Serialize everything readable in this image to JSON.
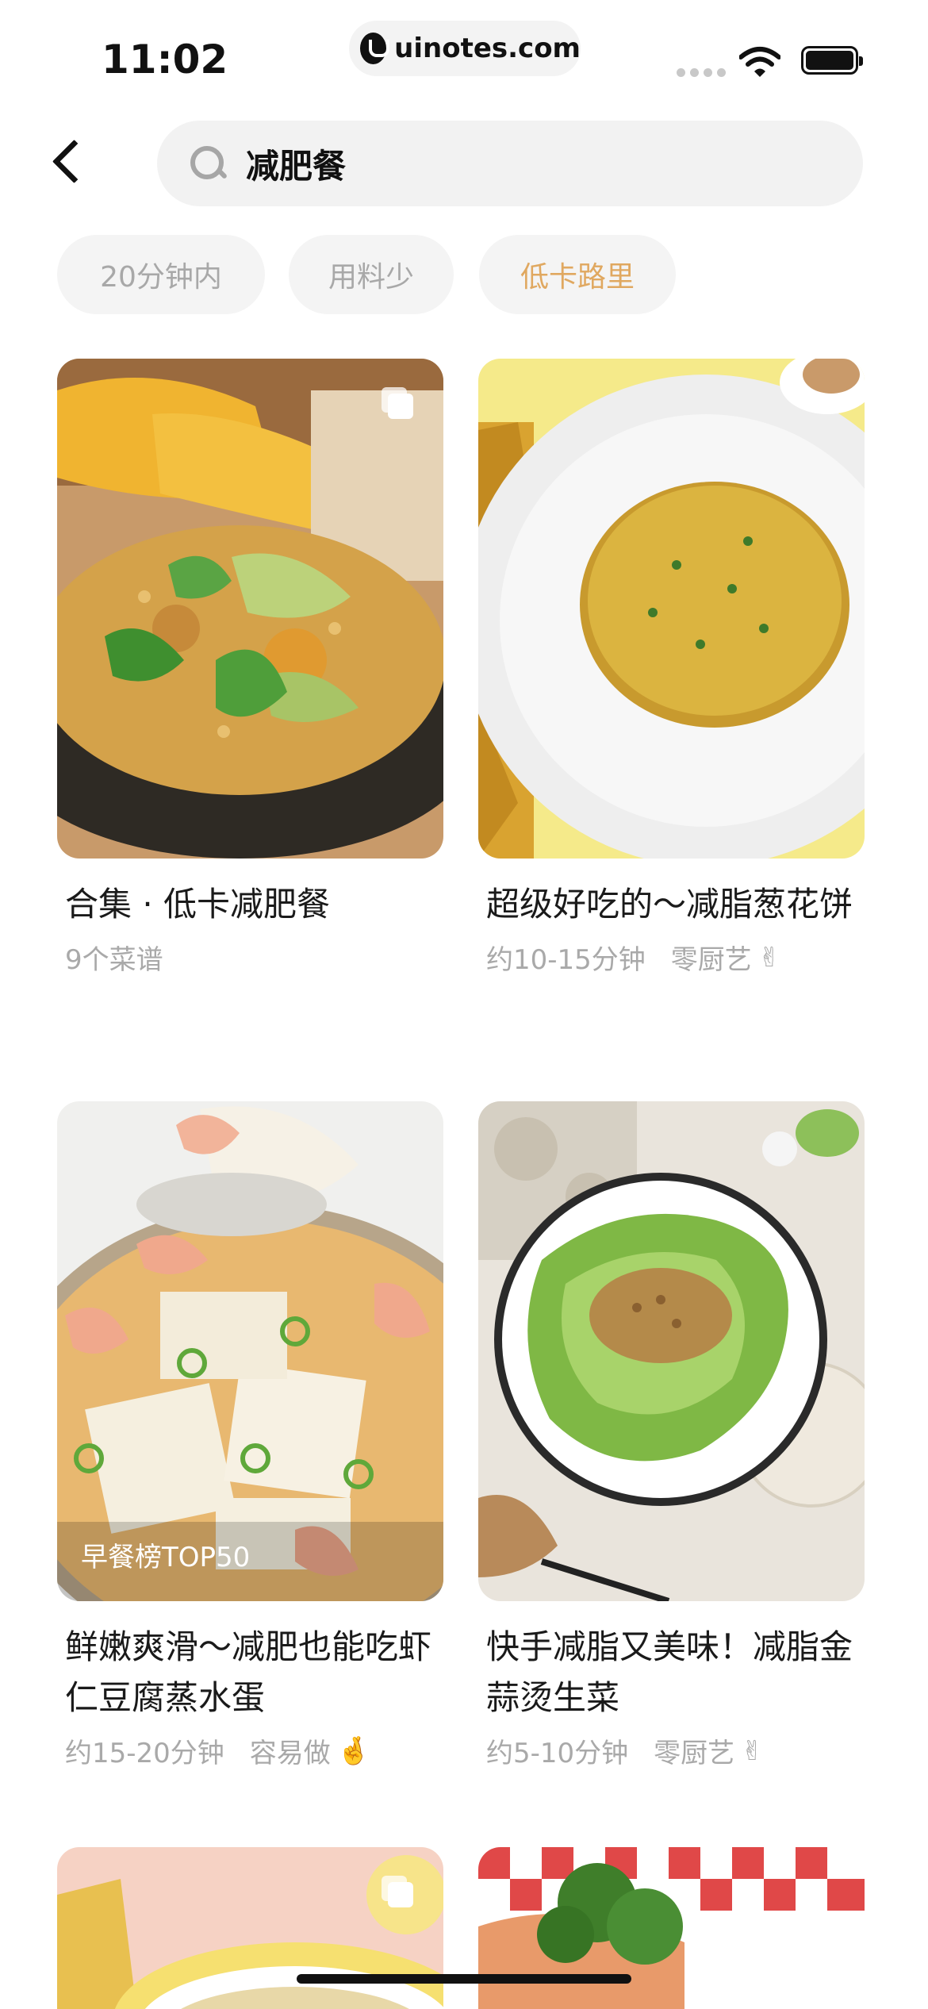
{
  "status_bar": {
    "time": "11:02",
    "url": "uinotes.com"
  },
  "search": {
    "query": "减肥餐"
  },
  "filters": [
    {
      "label": "20分钟内",
      "active": false
    },
    {
      "label": "用料少",
      "active": false
    },
    {
      "label": "低卡路里",
      "active": true
    }
  ],
  "cards": [
    {
      "title": "合集 · 低卡减肥餐",
      "meta": "9个菜谱",
      "meta_extra": "",
      "image_desc": "quinoa-avocado-salad-icon",
      "badge": ""
    },
    {
      "title": "超级好吃的～减脂葱花饼",
      "meta": "约10-15分钟",
      "meta_extra": "零厨艺",
      "image_desc": "egg-pancake-icon",
      "badge": ""
    },
    {
      "title": "鲜嫩爽滑～减肥也能吃虾仁豆腐蒸水蛋",
      "meta": "约15-20分钟",
      "meta_extra": "容易做",
      "image_desc": "shrimp-tofu-icon",
      "badge": "早餐榜TOP50"
    },
    {
      "title": "快手减脂又美味！减脂金蒜烫生菜",
      "meta": "约5-10分钟",
      "meta_extra": "零厨艺",
      "image_desc": "garlic-lettuce-icon",
      "badge": ""
    }
  ],
  "colors": {
    "accent": "#e0a860",
    "chip_bg": "#f4f4f4",
    "muted_text": "#a9a9a9"
  }
}
